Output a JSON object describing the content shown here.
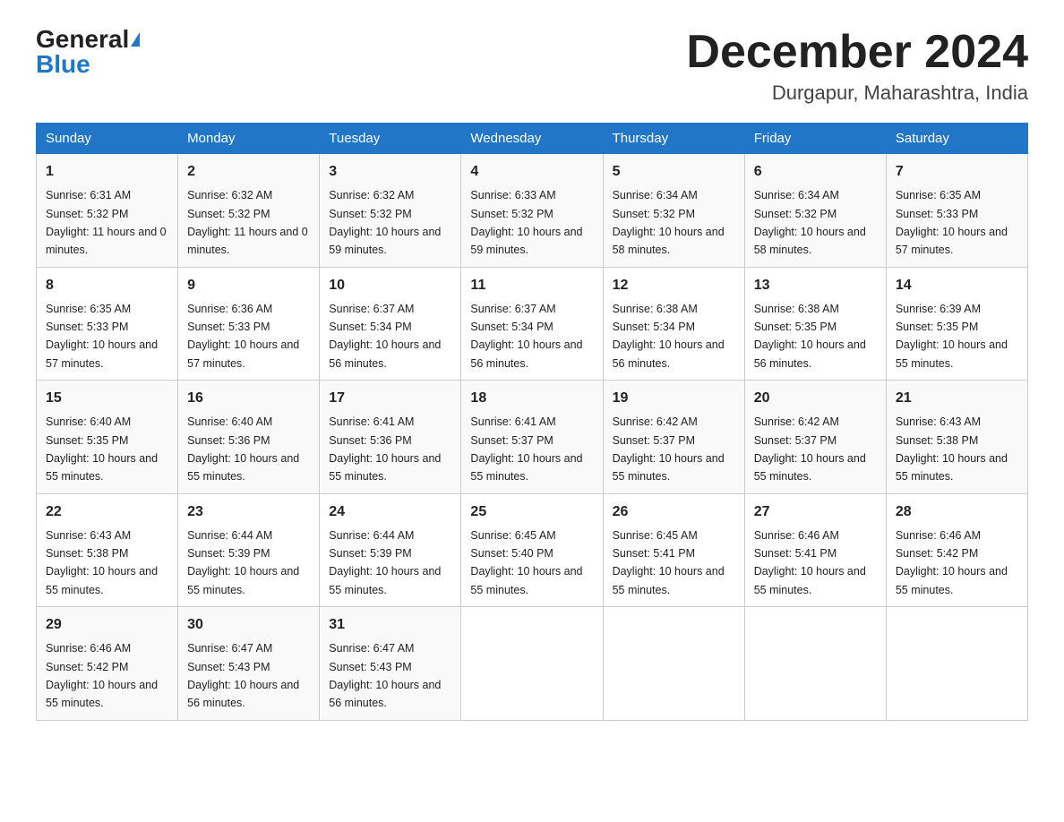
{
  "header": {
    "logo_general": "General",
    "logo_blue": "Blue",
    "title": "December 2024",
    "subtitle": "Durgapur, Maharashtra, India"
  },
  "days_of_week": [
    "Sunday",
    "Monday",
    "Tuesday",
    "Wednesday",
    "Thursday",
    "Friday",
    "Saturday"
  ],
  "weeks": [
    [
      {
        "day": "1",
        "sunrise": "6:31 AM",
        "sunset": "5:32 PM",
        "daylight": "11 hours and 0 minutes."
      },
      {
        "day": "2",
        "sunrise": "6:32 AM",
        "sunset": "5:32 PM",
        "daylight": "11 hours and 0 minutes."
      },
      {
        "day": "3",
        "sunrise": "6:32 AM",
        "sunset": "5:32 PM",
        "daylight": "10 hours and 59 minutes."
      },
      {
        "day": "4",
        "sunrise": "6:33 AM",
        "sunset": "5:32 PM",
        "daylight": "10 hours and 59 minutes."
      },
      {
        "day": "5",
        "sunrise": "6:34 AM",
        "sunset": "5:32 PM",
        "daylight": "10 hours and 58 minutes."
      },
      {
        "day": "6",
        "sunrise": "6:34 AM",
        "sunset": "5:32 PM",
        "daylight": "10 hours and 58 minutes."
      },
      {
        "day": "7",
        "sunrise": "6:35 AM",
        "sunset": "5:33 PM",
        "daylight": "10 hours and 57 minutes."
      }
    ],
    [
      {
        "day": "8",
        "sunrise": "6:35 AM",
        "sunset": "5:33 PM",
        "daylight": "10 hours and 57 minutes."
      },
      {
        "day": "9",
        "sunrise": "6:36 AM",
        "sunset": "5:33 PM",
        "daylight": "10 hours and 57 minutes."
      },
      {
        "day": "10",
        "sunrise": "6:37 AM",
        "sunset": "5:34 PM",
        "daylight": "10 hours and 56 minutes."
      },
      {
        "day": "11",
        "sunrise": "6:37 AM",
        "sunset": "5:34 PM",
        "daylight": "10 hours and 56 minutes."
      },
      {
        "day": "12",
        "sunrise": "6:38 AM",
        "sunset": "5:34 PM",
        "daylight": "10 hours and 56 minutes."
      },
      {
        "day": "13",
        "sunrise": "6:38 AM",
        "sunset": "5:35 PM",
        "daylight": "10 hours and 56 minutes."
      },
      {
        "day": "14",
        "sunrise": "6:39 AM",
        "sunset": "5:35 PM",
        "daylight": "10 hours and 55 minutes."
      }
    ],
    [
      {
        "day": "15",
        "sunrise": "6:40 AM",
        "sunset": "5:35 PM",
        "daylight": "10 hours and 55 minutes."
      },
      {
        "day": "16",
        "sunrise": "6:40 AM",
        "sunset": "5:36 PM",
        "daylight": "10 hours and 55 minutes."
      },
      {
        "day": "17",
        "sunrise": "6:41 AM",
        "sunset": "5:36 PM",
        "daylight": "10 hours and 55 minutes."
      },
      {
        "day": "18",
        "sunrise": "6:41 AM",
        "sunset": "5:37 PM",
        "daylight": "10 hours and 55 minutes."
      },
      {
        "day": "19",
        "sunrise": "6:42 AM",
        "sunset": "5:37 PM",
        "daylight": "10 hours and 55 minutes."
      },
      {
        "day": "20",
        "sunrise": "6:42 AM",
        "sunset": "5:37 PM",
        "daylight": "10 hours and 55 minutes."
      },
      {
        "day": "21",
        "sunrise": "6:43 AM",
        "sunset": "5:38 PM",
        "daylight": "10 hours and 55 minutes."
      }
    ],
    [
      {
        "day": "22",
        "sunrise": "6:43 AM",
        "sunset": "5:38 PM",
        "daylight": "10 hours and 55 minutes."
      },
      {
        "day": "23",
        "sunrise": "6:44 AM",
        "sunset": "5:39 PM",
        "daylight": "10 hours and 55 minutes."
      },
      {
        "day": "24",
        "sunrise": "6:44 AM",
        "sunset": "5:39 PM",
        "daylight": "10 hours and 55 minutes."
      },
      {
        "day": "25",
        "sunrise": "6:45 AM",
        "sunset": "5:40 PM",
        "daylight": "10 hours and 55 minutes."
      },
      {
        "day": "26",
        "sunrise": "6:45 AM",
        "sunset": "5:41 PM",
        "daylight": "10 hours and 55 minutes."
      },
      {
        "day": "27",
        "sunrise": "6:46 AM",
        "sunset": "5:41 PM",
        "daylight": "10 hours and 55 minutes."
      },
      {
        "day": "28",
        "sunrise": "6:46 AM",
        "sunset": "5:42 PM",
        "daylight": "10 hours and 55 minutes."
      }
    ],
    [
      {
        "day": "29",
        "sunrise": "6:46 AM",
        "sunset": "5:42 PM",
        "daylight": "10 hours and 55 minutes."
      },
      {
        "day": "30",
        "sunrise": "6:47 AM",
        "sunset": "5:43 PM",
        "daylight": "10 hours and 56 minutes."
      },
      {
        "day": "31",
        "sunrise": "6:47 AM",
        "sunset": "5:43 PM",
        "daylight": "10 hours and 56 minutes."
      },
      null,
      null,
      null,
      null
    ]
  ]
}
